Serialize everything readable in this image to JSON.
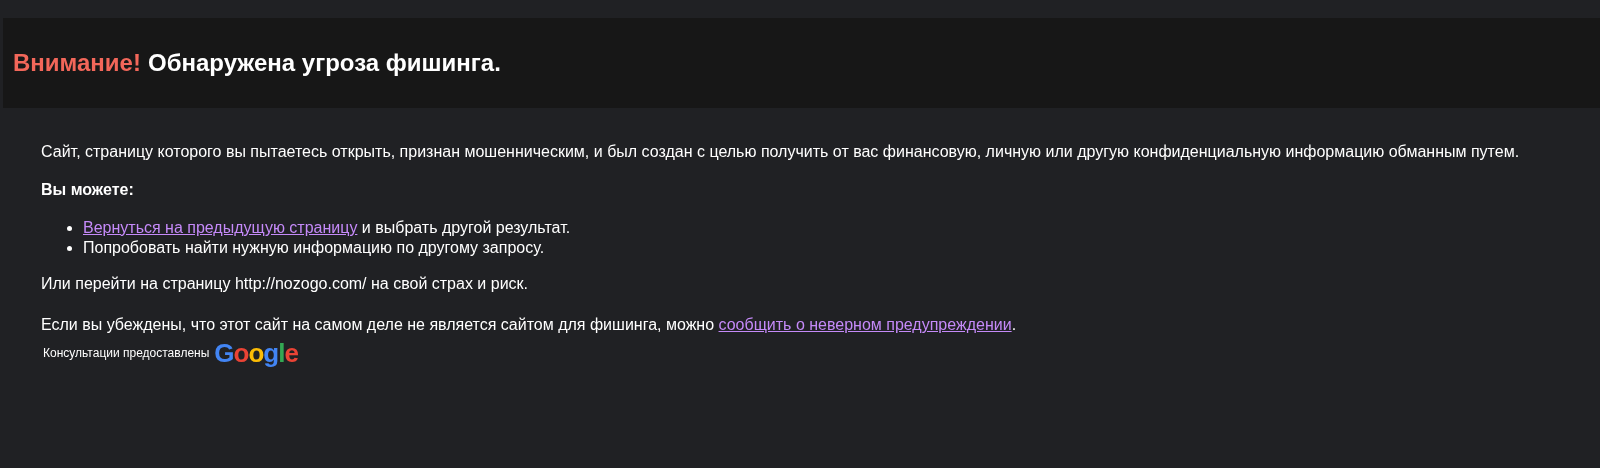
{
  "header": {
    "alert": "Внимание!",
    "title": "Обнаружена угроза фишинга."
  },
  "description": "Сайт, страницу которого вы пытаетесь открыть, признан мошенническим, и был создан с целью получить от вас финансовую, личную или другую конфиденциальную информацию обманным путем.",
  "options_heading": "Вы можете:",
  "options": [
    {
      "link": "Вернуться на предыдущую страницу",
      "text": " и выбрать другой результат."
    },
    {
      "text": "Попробовать найти нужную информацию по другому запросу."
    }
  ],
  "proceed": "Или перейти на страницу http://nozogo.com/ на свой страх и риск.",
  "report": {
    "before": "Если вы убеждены, что этот сайт на самом деле не является сайтом для фишинга, можно ",
    "link": "сообщить о неверном предупреждении",
    "after": "."
  },
  "footer": {
    "text": "Консультации предоставлены",
    "logo": "Google"
  }
}
